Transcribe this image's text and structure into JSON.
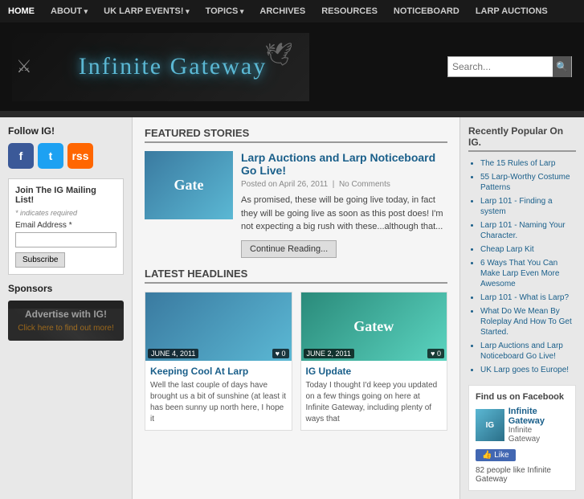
{
  "nav": {
    "items": [
      {
        "label": "HOME",
        "href": "#",
        "has_arrow": false
      },
      {
        "label": "ABOUT",
        "href": "#",
        "has_arrow": true
      },
      {
        "label": "UK LARP EVENTS!",
        "href": "#",
        "has_arrow": true
      },
      {
        "label": "TOPICS",
        "href": "#",
        "has_arrow": true
      },
      {
        "label": "ARCHIVES",
        "href": "#",
        "has_arrow": false
      },
      {
        "label": "RESOURCES",
        "href": "#",
        "has_arrow": false
      },
      {
        "label": "NOTICEBOARD",
        "href": "#",
        "has_arrow": false
      },
      {
        "label": "LARP AUCTIONS",
        "href": "#",
        "has_arrow": false
      }
    ]
  },
  "header": {
    "logo_text": "Infinite Gateway",
    "search_placeholder": "Search...",
    "search_label": "Search .",
    "search_icon": "🔍"
  },
  "left_sidebar": {
    "follow_title": "Follow IG!",
    "social": [
      {
        "name": "Facebook",
        "short": "f",
        "type": "fb"
      },
      {
        "name": "Twitter",
        "short": "t",
        "type": "tw"
      },
      {
        "name": "RSS",
        "short": "RSS",
        "type": "rss"
      }
    ],
    "mailing": {
      "title": "Join The IG Mailing List!",
      "required_note": "* indicates required",
      "email_label": "Email Address *",
      "email_placeholder": "",
      "subscribe_btn": "Subscribe"
    },
    "sponsors_title": "Sponsors",
    "advertise": {
      "title": "Advertise with IG!",
      "link_text": "Click here to find out more!"
    }
  },
  "center": {
    "featured_title": "FEATURED STORIES",
    "featured_article": {
      "thumb_text": "Gate",
      "title": "Larp Auctions and Larp Noticeboard Go Live!",
      "date": "April 26, 2011",
      "pipe": "|",
      "comments": "No Comments",
      "excerpt": "As promised, these will be going live today, in fact they will be going live as soon as this post does!  I'm not expecting a big rush with these...although that...",
      "continue_btn": "Continue Reading..."
    },
    "latest_title": "LATEST HEADLINES",
    "latest_articles": [
      {
        "thumb_text": "",
        "thumb_type": "blue",
        "date": "JUNE 4, 2011",
        "comments": "♥ 0",
        "title": "Keeping Cool At Larp",
        "excerpt": "Well the last couple of days have brought us a bit of sunshine (at least it has been sunny up north here, I hope it"
      },
      {
        "thumb_text": "Gatew",
        "thumb_type": "teal",
        "date": "JUNE 2, 2011",
        "comments": "♥ 0",
        "title": "IG Update",
        "excerpt": "Today I thought I'd keep you updated on a few things going on here at Infinite Gateway, including plenty of ways that"
      }
    ]
  },
  "right_sidebar": {
    "popular_title": "Recently Popular On IG.",
    "popular_items": [
      "The 15 Rules of Larp",
      "55 Larp-Worthy Costume Patterns",
      "Larp 101 - Finding a system",
      "Larp 101 - Naming Your Character.",
      "Cheap Larp Kit",
      "6 Ways That You Can Make Larp Even More Awesome",
      "Larp 101 - What is Larp?",
      "What Do We Mean By Roleplay And How To Get Started.",
      "Larp Auctions and Larp Noticeboard Go Live!",
      "UK Larp goes to Europe!"
    ],
    "facebook_title": "Find us on Facebook",
    "facebook_page": {
      "name": "Infinite Gateway",
      "sub": "",
      "like_btn": "👍 Like",
      "count_text": "82 people like Infinite Gateway"
    }
  }
}
